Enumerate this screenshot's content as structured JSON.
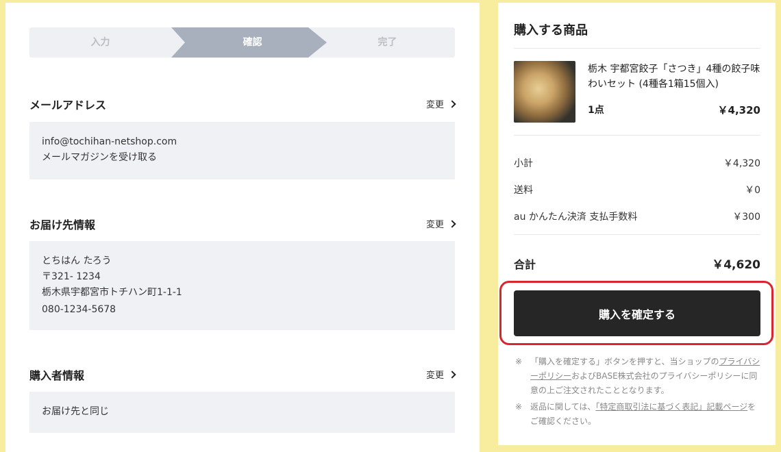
{
  "stepper": {
    "steps": [
      "入力",
      "確認",
      "完了"
    ]
  },
  "sections": {
    "email": {
      "title": "メールアドレス",
      "change_label": "変更",
      "lines": [
        "info@tochihan-netshop.com",
        "メールマガジンを受け取る"
      ]
    },
    "shipping": {
      "title": "お届け先情報",
      "change_label": "変更",
      "lines": [
        "とちはん たろう",
        "〒321- 1234",
        "栃木県宇都宮市トチハン町1-1-1",
        "080-1234-5678"
      ]
    },
    "buyer": {
      "title": "購入者情報",
      "change_label": "変更",
      "lines": [
        "お届け先と同じ"
      ]
    }
  },
  "cart": {
    "title": "購入する商品",
    "product": {
      "name": "栃木 宇都宮餃子「さつき」4種の餃子味わいセット (4種各1箱15個入)",
      "quantity": "1点",
      "price": "￥4,320",
      "image": "gyoza-photo"
    },
    "summary": {
      "subtotal_label": "小計",
      "subtotal_value": "￥4,320",
      "shipping_label": "送料",
      "shipping_value": "￥0",
      "fee_label": "au かんたん決済 支払手数料",
      "fee_value": "￥300",
      "total_label": "合計",
      "total_value": "￥4,620"
    },
    "confirm_button": "購入を確定する",
    "highlight_color": "#d9252b",
    "notes": {
      "mark": "※",
      "note1_pre": "「購入を確定する」ボタンを押すと、当ショップの",
      "note1_link": "プライバシーポリシー",
      "note1_post": "およびBASE株式会社のプライバシーポリシーに同意の上ご注文されたこととなります。",
      "note2_pre": "返品に関しては、",
      "note2_link": "「特定商取引法に基づく表記」記載ページ",
      "note2_post": "をご確認ください。"
    }
  }
}
